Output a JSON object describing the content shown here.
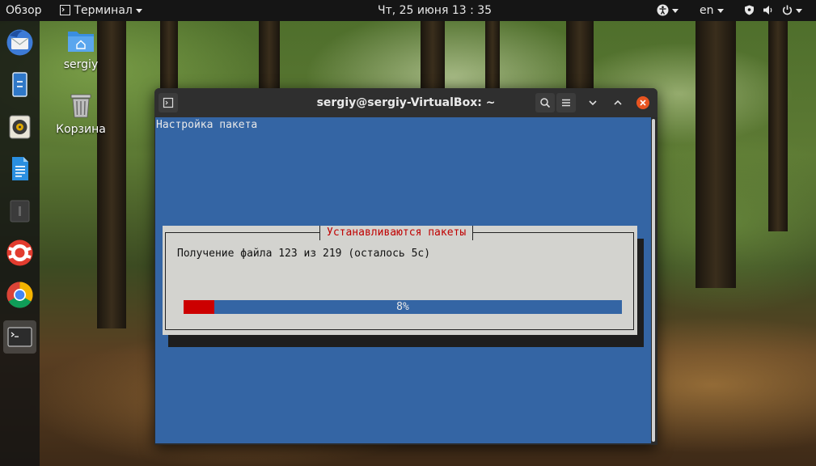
{
  "topbar": {
    "activities": "Обзор",
    "app_menu": "Терминал",
    "clock": "Чт, 25 июня  13 : 35",
    "language": "en"
  },
  "desktop": {
    "home_label": "sergiy",
    "trash_label": "Корзина"
  },
  "dock": {
    "items": [
      "thunderbird-icon",
      "files-icon",
      "rhythmbox-icon",
      "libreoffice-writer-icon",
      "software-icon",
      "help-icon",
      "chrome-icon",
      "terminal-icon"
    ]
  },
  "window": {
    "title": "sergiy@sergiy-VirtualBox: ~"
  },
  "terminal": {
    "heading": "Настройка пакета",
    "dialog": {
      "title": "Устанавливаются пакеты",
      "message": "Получение файла 123 из 219 (осталось 5с)",
      "progress_percent": 8,
      "progress_label": "8%"
    }
  },
  "colors": {
    "terminal_bg": "#3465a4",
    "dialog_bg": "#d3d3cf",
    "accent_red": "#cc0000",
    "close_button": "#e95420"
  }
}
